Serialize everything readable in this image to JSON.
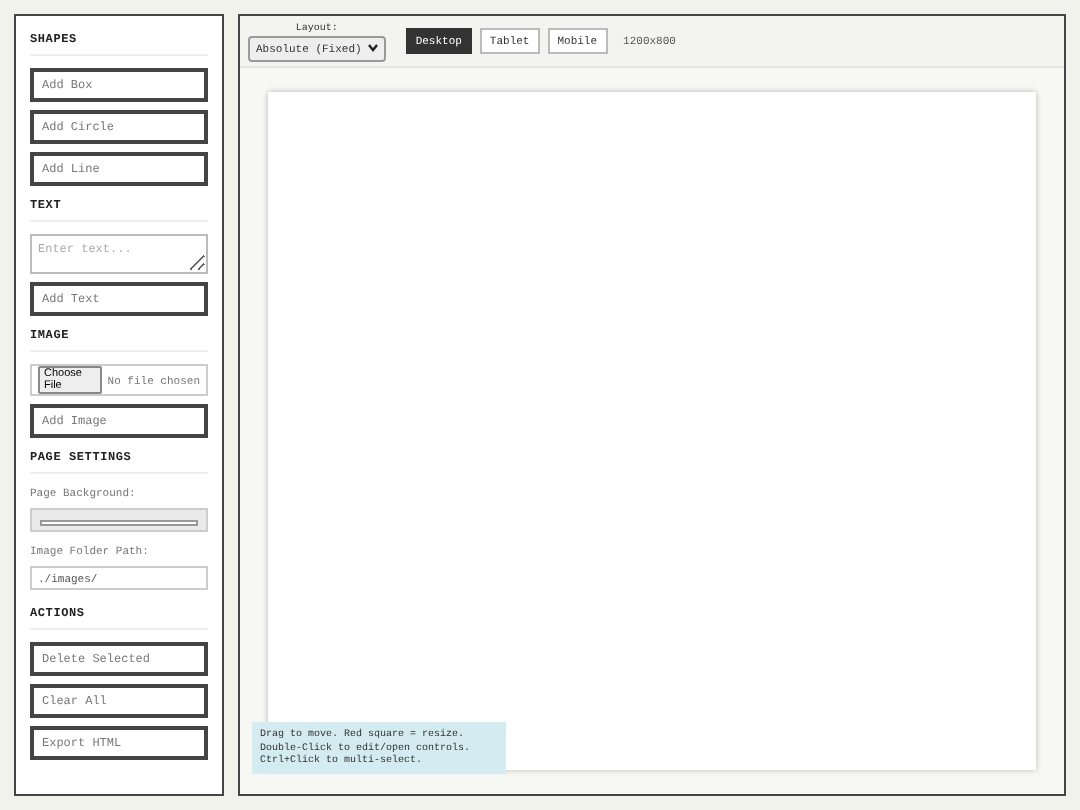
{
  "sidebar": {
    "sections": [
      {
        "heading": "SHAPES",
        "items": [
          {
            "kind": "button",
            "label": "Add Box"
          },
          {
            "kind": "button",
            "label": "Add Circle"
          },
          {
            "kind": "button",
            "label": "Add Line"
          }
        ]
      },
      {
        "heading": "TEXT",
        "items": [
          {
            "kind": "textarea",
            "placeholder": "Enter text..."
          },
          {
            "kind": "button",
            "label": "Add Text"
          }
        ]
      },
      {
        "heading": "IMAGE",
        "items": [
          {
            "kind": "file",
            "button": "Choose File",
            "status": "No file chosen"
          },
          {
            "kind": "button",
            "label": "Add Image"
          }
        ]
      },
      {
        "heading": "PAGE SETTINGS",
        "items": [
          {
            "kind": "color",
            "label": "Page Background:"
          },
          {
            "kind": "input",
            "label": "Image Folder Path:",
            "value": "./images/"
          }
        ]
      },
      {
        "heading": "ACTIONS",
        "items": [
          {
            "kind": "button",
            "label": "Delete Selected"
          },
          {
            "kind": "button",
            "label": "Clear All"
          },
          {
            "kind": "button",
            "label": "Export HTML"
          }
        ]
      }
    ]
  },
  "toolbar": {
    "layout_label": "Layout:",
    "layout_value": "Absolute (Fixed)",
    "devices": [
      {
        "label": "Desktop",
        "selected": true
      },
      {
        "label": "Tablet",
        "selected": false
      },
      {
        "label": "Mobile",
        "selected": false
      }
    ],
    "size": "1200x800"
  },
  "hint": "Drag to move. Red square = resize.\nDouble-Click to edit/open controls.\nCtrl+Click to multi-select."
}
